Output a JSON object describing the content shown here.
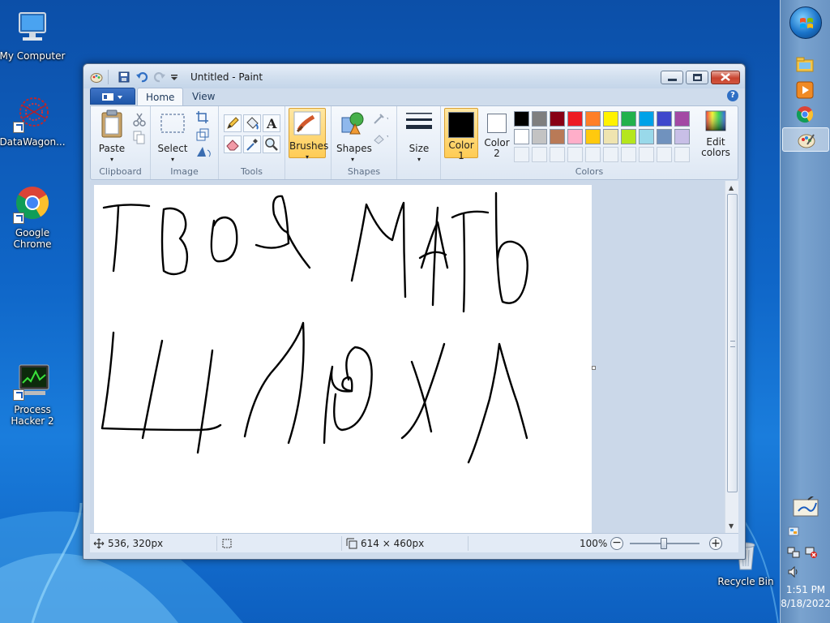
{
  "desktop": {
    "icons": [
      {
        "label": "My Computer"
      },
      {
        "label": "DataWagon..."
      },
      {
        "label": "Google Chrome"
      },
      {
        "label": "Process Hacker 2"
      },
      {
        "label": "Recycle Bin"
      }
    ]
  },
  "window": {
    "title": "Untitled - Paint"
  },
  "ribbon": {
    "tabs": [
      {
        "label": "Home"
      },
      {
        "label": "View"
      }
    ],
    "groups": {
      "clipboard": {
        "label": "Clipboard",
        "paste": "Paste"
      },
      "image": {
        "label": "Image",
        "select": "Select"
      },
      "tools": {
        "label": "Tools"
      },
      "brushes": {
        "label": "Brushes"
      },
      "shapes": {
        "label": "Shapes",
        "shapes_btn": "Shapes"
      },
      "size": {
        "label": "Size"
      },
      "colors": {
        "label": "Colors",
        "color1_line1": "Color",
        "color1_line2": "1",
        "color2_line1": "Color",
        "color2_line2": "2",
        "edit_line1": "Edit",
        "edit_line2": "colors",
        "color1": "#000000",
        "color2": "#ffffff",
        "palette_row1": [
          "#000000",
          "#7f7f7f",
          "#880015",
          "#ed1c24",
          "#ff7f27",
          "#fff200",
          "#22b14c",
          "#00a2e8",
          "#3f48cc",
          "#a349a4"
        ],
        "palette_row2": [
          "#ffffff",
          "#c3c3c3",
          "#b97a57",
          "#ffaec9",
          "#ffc90e",
          "#efe4b0",
          "#b5e61d",
          "#99d9ea",
          "#7092be",
          "#c8bfe7"
        ]
      }
    }
  },
  "canvas": {
    "handwriting": "ТВОЯ МАТЬ ШЛЮХА"
  },
  "statusbar": {
    "cursor_pos": "536, 320px",
    "canvas_size": "614 × 460px",
    "zoom": "100%"
  },
  "tray": {
    "time": "1:51 PM",
    "date": "8/18/2022"
  }
}
